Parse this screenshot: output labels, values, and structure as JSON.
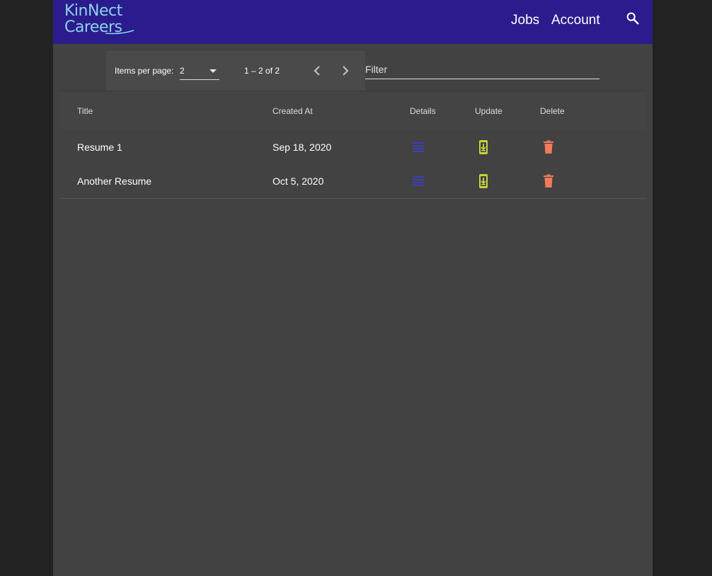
{
  "brand": {
    "logo_line1": "KinNect",
    "logo_line2": "Careers"
  },
  "nav": {
    "jobs": "Jobs",
    "account": "Account",
    "search_icon": "search-icon"
  },
  "paginator": {
    "items_per_page_label": "Items per page:",
    "items_per_page_value": "2",
    "range_label": "1 – 2 of 2",
    "prev_icon": "chevron-left-icon",
    "next_icon": "chevron-right-icon"
  },
  "filter": {
    "placeholder": "Filter",
    "value": ""
  },
  "table": {
    "columns": [
      "Title",
      "Created At",
      "Details",
      "Update",
      "Delete"
    ],
    "rows": [
      {
        "title": "Resume 1",
        "created_at": "Sep 18, 2020"
      },
      {
        "title": "Another Resume",
        "created_at": "Oct 5, 2020"
      }
    ],
    "icons": {
      "details": "subject-icon",
      "update": "system-update-icon",
      "delete": "delete-icon"
    }
  },
  "colors": {
    "toolbar": "#2a1c8c",
    "page_bg": "#424242",
    "outer_bg": "#222222",
    "details_icon": "#3f3fb8",
    "update_icon": "#c8d23a",
    "delete_icon": "#f07a5a",
    "logo": "#8fd0ee"
  }
}
